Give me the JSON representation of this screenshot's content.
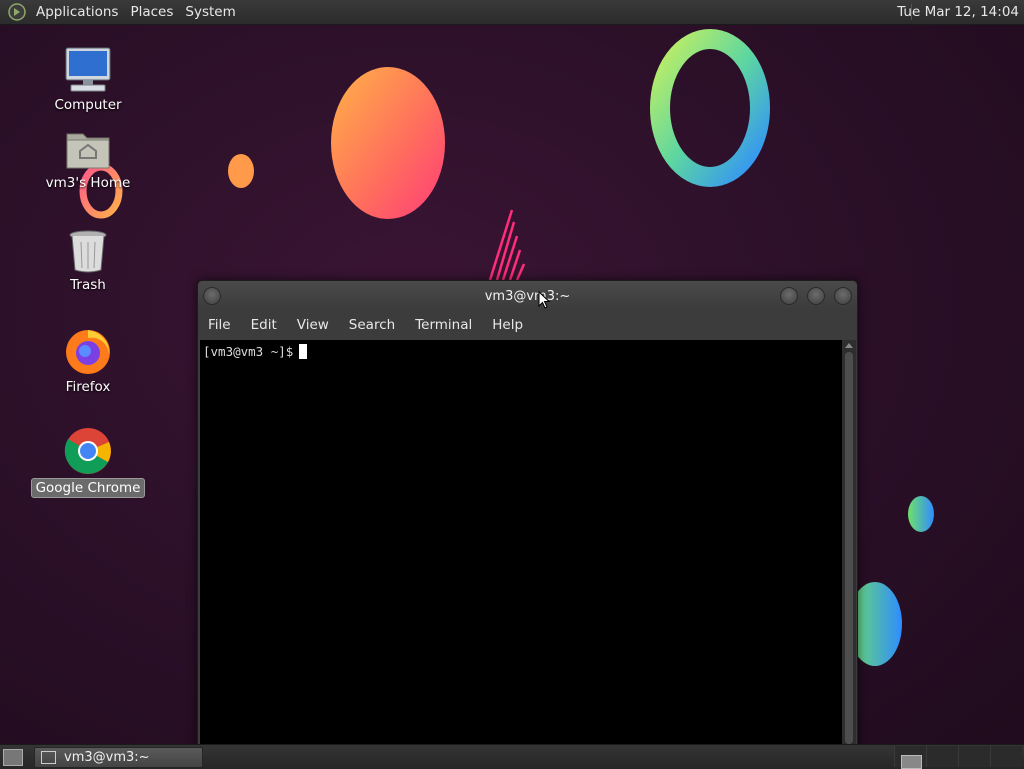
{
  "top_panel": {
    "menus": [
      "Applications",
      "Places",
      "System"
    ],
    "clock": "Tue Mar 12, 14:04"
  },
  "desktop_icons": [
    {
      "label": "Computer",
      "icon": "computer-icon"
    },
    {
      "label": "vm3's Home",
      "icon": "home-folder-icon"
    },
    {
      "label": "Trash",
      "icon": "trash-icon"
    },
    {
      "label": "Firefox",
      "icon": "firefox-icon"
    },
    {
      "label": "Google Chrome",
      "icon": "chrome-icon",
      "selected": true
    }
  ],
  "terminal": {
    "title": "vm3@vm3:~",
    "menus": [
      "File",
      "Edit",
      "View",
      "Search",
      "Terminal",
      "Help"
    ],
    "prompt": "[vm3@vm3 ~]$"
  },
  "bottom_panel": {
    "task_label": "vm3@vm3:~",
    "workspaces": 4
  },
  "colors": {
    "desktop_bg": "#2a1024",
    "panel_bg": "#2f2f2f",
    "terminal_bg": "#000000"
  }
}
